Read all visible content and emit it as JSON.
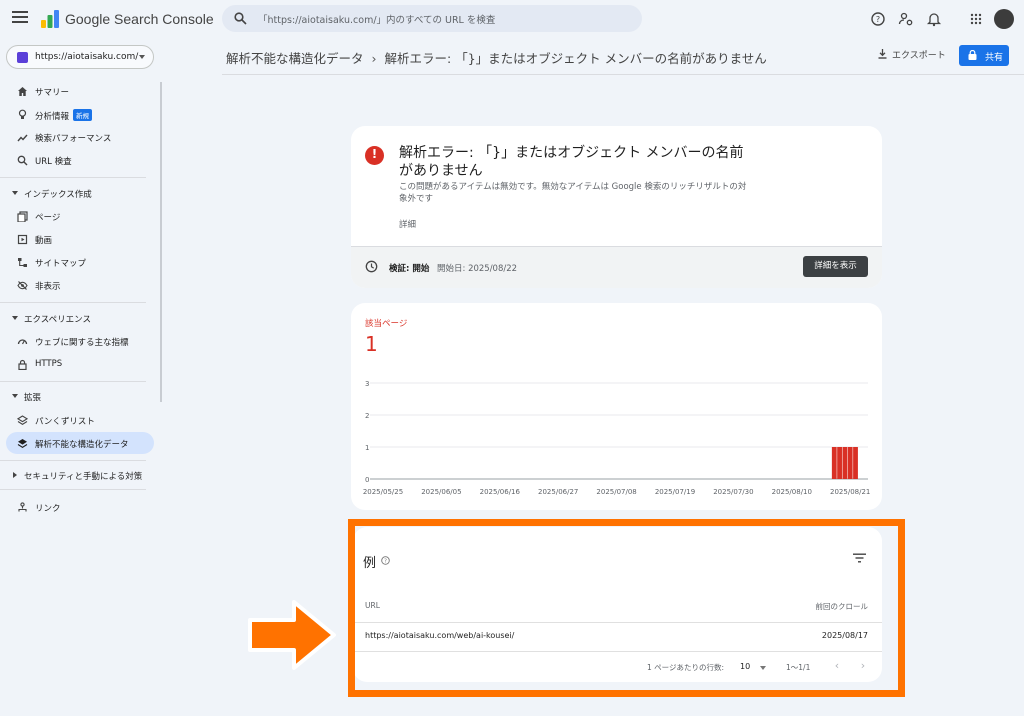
{
  "app": {
    "brand": "Google Search Console",
    "search_placeholder": "「https://aiotaisaku.com/」内のすべての URL を検査"
  },
  "property": {
    "name": "https://aiotaisaku.com/"
  },
  "sidebar": {
    "summary": "サマリー",
    "insights": "分析情報",
    "insights_badge": "新規",
    "performance": "検索パフォーマンス",
    "url_inspection": "URL 検査",
    "indexing_section": "インデックス作成",
    "pages": "ページ",
    "video": "動画",
    "sitemaps": "サイトマップ",
    "removals": "非表示",
    "experience_section": "エクスペリエンス",
    "core_web_vitals": "ウェブに関する主な指標",
    "https": "HTTPS",
    "enhancements_section": "拡張",
    "breadcrumbs": "パンくずリスト",
    "unparsable": "解析不能な構造化データ",
    "security_section": "セキュリティと手動による対策",
    "links": "リンク"
  },
  "header": {
    "crumb_parent": "解析不能な構造化データ",
    "crumb_sep": "›",
    "crumb_current": "解析エラー: 「}」またはオブジェクト メンバーの名前がありません",
    "export_label": "エクスポート",
    "share_label": "共有"
  },
  "issue": {
    "title": "解析エラー: 「}」またはオブジェクト メンバーの名前がありません",
    "description": "この問題があるアイテムは無効です。無効なアイテムは Google 検索のリッチリザルトの対象外です",
    "details_link": "詳細",
    "validation_label": "検証: 開始",
    "validation_date": "開始日: 2025/08/22",
    "details_button": "詳細を表示"
  },
  "affected": {
    "label": "該当ページ",
    "value": "1"
  },
  "chart_data": {
    "type": "bar",
    "x_ticks": [
      "2025/05/25",
      "2025/06/05",
      "2025/06/16",
      "2025/06/27",
      "2025/07/08",
      "2025/07/19",
      "2025/07/30",
      "2025/08/10",
      "2025/08/21"
    ],
    "y_ticks": [
      0,
      1,
      2,
      3
    ],
    "ylim": [
      0,
      3
    ],
    "series": [
      {
        "color": "#d93025",
        "points": [
          {
            "x": "2025/08/18",
            "y": 1
          },
          {
            "x": "2025/08/19",
            "y": 1
          },
          {
            "x": "2025/08/20",
            "y": 1
          },
          {
            "x": "2025/08/21",
            "y": 1
          },
          {
            "x": "2025/08/22",
            "y": 1
          }
        ]
      }
    ]
  },
  "examples": {
    "title": "例",
    "col_url": "URL",
    "col_crawl": "前回のクロール",
    "rows": [
      {
        "url": "https://aiotaisaku.com/web/ai-kousei/",
        "crawled": "2025/08/17"
      }
    ],
    "rows_per_page_label": "1 ページあたりの行数:",
    "rows_per_page": "10",
    "range": "1～1/1"
  },
  "colors": {
    "accent": "#1a73e8",
    "error": "#d93025",
    "annotation": "#ff7200"
  }
}
